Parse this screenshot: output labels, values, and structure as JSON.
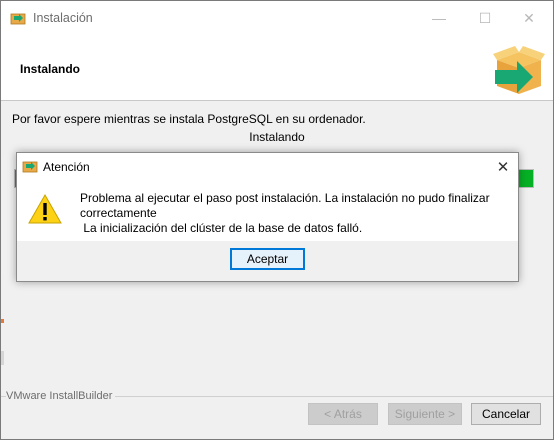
{
  "window": {
    "title": "Instalación",
    "icon": "installer-box-icon",
    "controls": {
      "minimize": "—",
      "maximize": "☐",
      "close": "✕"
    }
  },
  "header": {
    "title": "Instalando",
    "logo": "bitrock-box-logo"
  },
  "body": {
    "message": "Por favor espere mientras se instala PostgreSQL en su ordenador.",
    "status": "Instalando",
    "progress_fraction": 1.0
  },
  "footer": {
    "brand": "VMware InstallBuilder",
    "back_label": "< Atrás",
    "next_label": "Siguiente >",
    "cancel_label": "Cancelar"
  },
  "dialog": {
    "title": "Atención",
    "icon": "warning-icon",
    "close": "✕",
    "message": "Problema al ejecutar el paso post instalación. La instalación no pudo finalizar correctamente\n La inicialización del clúster de la base de datos falló.",
    "ok_label": "Aceptar"
  },
  "colors": {
    "progress": "#06b025",
    "focus_border": "#0078d7",
    "warning_yellow": "#fcd116"
  }
}
